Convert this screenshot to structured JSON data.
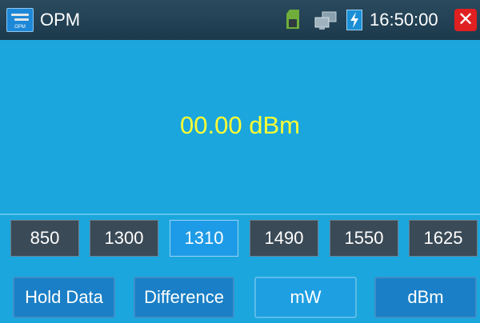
{
  "titlebar": {
    "app_title": "OPM",
    "app_icon_caption": "OPM",
    "clock": "16:50:00",
    "close_glyph": "✕",
    "icons": [
      "sd-card-icon",
      "network-icon",
      "battery-charging-icon",
      "close-icon"
    ]
  },
  "display": {
    "reading": "00.00 dBm"
  },
  "wavelengths": [
    {
      "label": "850",
      "active": false
    },
    {
      "label": "1300",
      "active": false
    },
    {
      "label": "1310",
      "active": true
    },
    {
      "label": "1490",
      "active": false
    },
    {
      "label": "1550",
      "active": false
    },
    {
      "label": "1625",
      "active": false
    }
  ],
  "actions": {
    "hold_data": "Hold Data",
    "difference": "Difference",
    "mw": "mW",
    "dbm": "dBm"
  },
  "colors": {
    "background": "#1ba6dd",
    "reading_text": "#ffff33",
    "active_wavelength": "#1e9be6",
    "inactive_wavelength": "#3a4a56",
    "close_button": "#e02020"
  }
}
